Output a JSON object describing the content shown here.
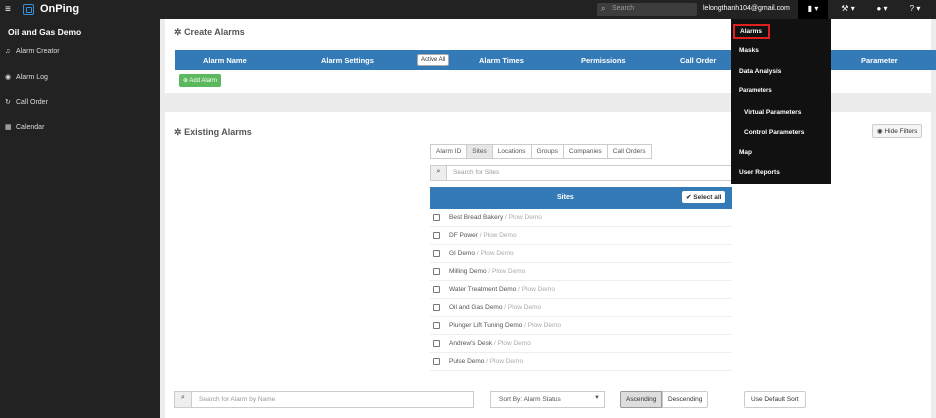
{
  "topbar": {
    "brand": "OnPing",
    "search_placeholder": "Search",
    "user_email": "lelongthanh104@gmail.com",
    "menu_caret": "▾"
  },
  "sidebar": {
    "company": "Oil and Gas Demo",
    "items": [
      {
        "label": "Alarm Creator",
        "icon": "bell-icon"
      },
      {
        "label": "Alarm Log",
        "icon": "eye-icon"
      },
      {
        "label": "Call Order",
        "icon": "refresh-icon"
      },
      {
        "label": "Calendar",
        "icon": "calendar-icon"
      }
    ]
  },
  "create": {
    "title": "Create Alarms",
    "columns": [
      "Alarm Name",
      "Alarm Settings",
      "Alarm Times",
      "Permissions",
      "Call Order",
      "Parameter"
    ],
    "activate_all": "Active All",
    "add_alarm": "Add Alarm"
  },
  "existing": {
    "title": "Existing Alarms",
    "hide_filters": "Hide Filters",
    "tabs": [
      "Alarm ID",
      "Sites",
      "Locations",
      "Groups",
      "Companies",
      "Call Orders"
    ],
    "active_tab": "Sites",
    "sites_search_placeholder": "Search for Sites",
    "sites_header": "Sites",
    "select_all": "Select all",
    "sites": [
      {
        "name": "Best Bread Bakery",
        "org": "/ Plow Demo"
      },
      {
        "name": "DF Power",
        "org": "/ Plow Demo"
      },
      {
        "name": "GI Demo",
        "org": "/ Plow Demo"
      },
      {
        "name": "Milling Demo",
        "org": "/ Plow Demo"
      },
      {
        "name": "Water Treatment Demo",
        "org": "/ Plow Demo"
      },
      {
        "name": "Oil and Gas Demo",
        "org": "/ Plow Demo"
      },
      {
        "name": "Plunger Lift Tuning Demo",
        "org": "/ Plow Demo"
      },
      {
        "name": "Andrew's Desk",
        "org": "/ Plow Demo"
      },
      {
        "name": "Pulse Demo",
        "org": "/ Plow Demo"
      }
    ],
    "alarm_search_placeholder": "Search for Alarm by Name",
    "sort_by": "Sort By: Alarm Status",
    "ascending": "Ascending",
    "descending": "Descending",
    "default_sort": "Use Default Sort"
  },
  "dropdown": {
    "items": [
      {
        "label": "Alarms",
        "indent": false,
        "highlight": true
      },
      {
        "label": "Masks",
        "indent": false
      },
      {
        "label": "Data Analysis",
        "indent": false
      },
      {
        "label": "Parameters",
        "indent": false,
        "small": true
      },
      {
        "label": "Virtual Parameters",
        "indent": true
      },
      {
        "label": "Control Parameters",
        "indent": true
      },
      {
        "label": "Map",
        "indent": false
      },
      {
        "label": "User Reports",
        "indent": false
      }
    ]
  },
  "colors": {
    "navbar": "#222222",
    "primary": "#337ab7",
    "success": "#5cb85c",
    "highlight": "#e02020"
  }
}
